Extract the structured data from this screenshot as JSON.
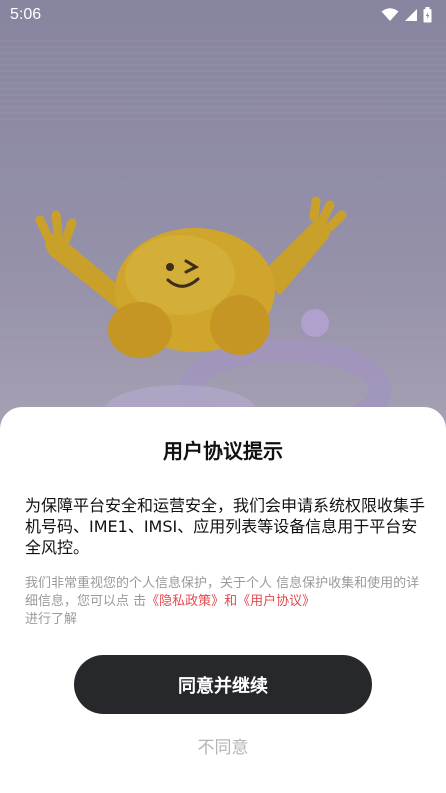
{
  "status_bar": {
    "time": "5:06",
    "icons": [
      "wifi-icon",
      "cellular-signal-icon",
      "battery-icon"
    ]
  },
  "background": {
    "icon": "mascot-illustration"
  },
  "dialog": {
    "title": "用户协议提示",
    "body": "为保障平台安全和运营安全，我们会申请系统权限收集手机号码、IME1、IMSI、应用列表等设备信息用于平台安全风控。",
    "note_prefix": "我们非常重视您的个人信息保护，关于个人 信息保护收集和使用的详细信息，您可以点 击",
    "privacy_link": "《隐私政策》",
    "note_and": "和",
    "terms_link": "《用户协议》",
    "note_suffix": "进行了解",
    "agree_label": "同意并继续",
    "disagree_label": "不同意"
  },
  "colors": {
    "link": "#e5484d",
    "primary_button": "#27282c",
    "secondary_text": "#9a9a9a"
  }
}
